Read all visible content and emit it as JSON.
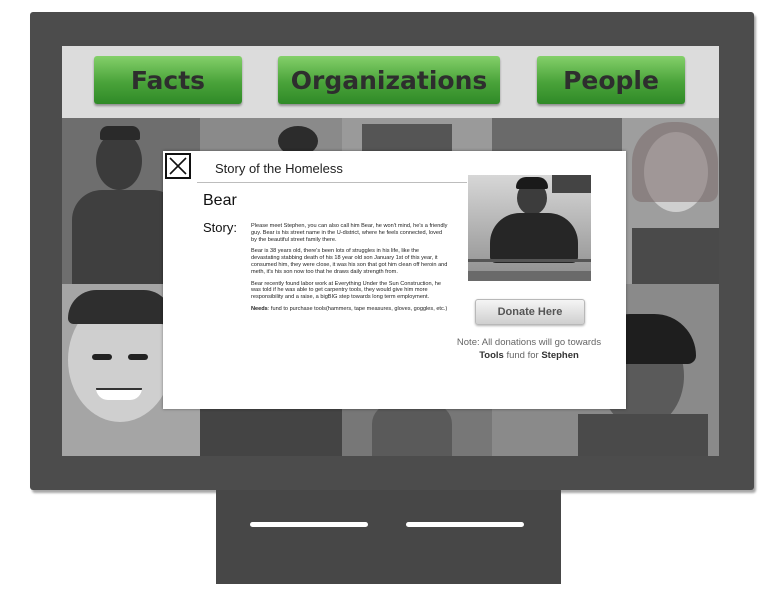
{
  "nav": {
    "facts_label": "Facts",
    "organizations_label": "Organizations",
    "people_label": "People"
  },
  "modal": {
    "close_icon": "close-x-icon",
    "title": "Story of the Homeless",
    "name": "Bear",
    "story_label": "Story:",
    "paragraphs": [
      "Please meet Stephen, you can also call him Bear, he won't mind, he's a friendly guy. Bear is his street name in the U-district, where he feels connected, loved by the beautiful street family there.",
      "Bear is 38 years old, there's been lots of struggles in his life, like the devastating stabbing death of his 18 year old son January 1st of this year, it consumed him, they were close, it was his son that got him clean off heroin and meth, it's his son now too that he draws daily strength from.",
      "Bear recently found labor work at Everything Under the Sun Construction, he was told if he was able to get carpentry tools, they would give him more responsibility and a raise, a bigBIG step towards long term employment."
    ],
    "needs_label": "Needs",
    "needs_text": ": fund to purchase tools(hammers, tape measures, gloves, goggles, etc.)",
    "donate_label": "Donate Here",
    "note_prefix": "Note: All donations will go towards",
    "note_fund": "Tools",
    "note_middle": " fund for ",
    "note_person": "Stephen"
  },
  "colors": {
    "monitor": "#4c4c4c",
    "nav_button_green": "#4aa33a",
    "screen_bg": "#dcdcdc"
  }
}
